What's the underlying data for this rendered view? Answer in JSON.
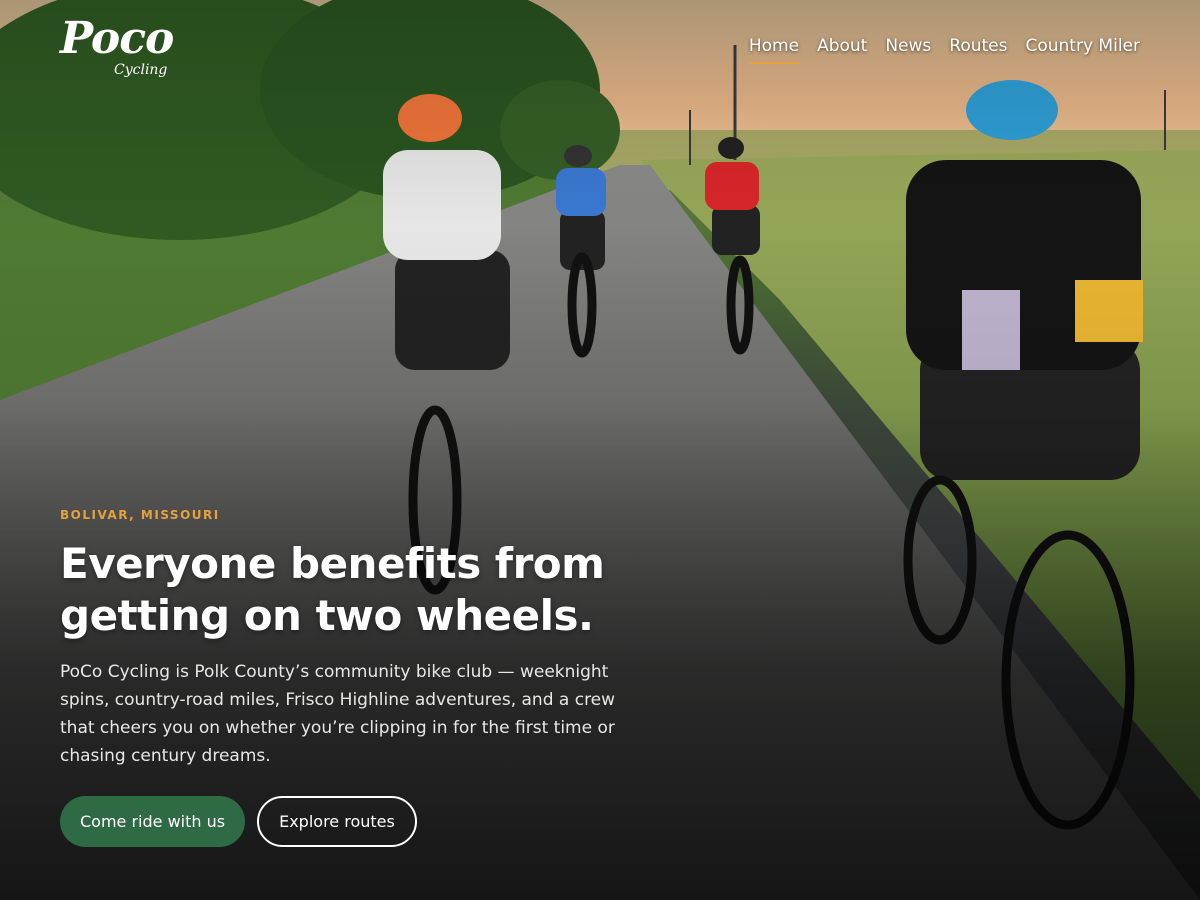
{
  "brand": {
    "logo_main": "Poco",
    "logo_sub": "Cycling"
  },
  "nav": {
    "items": [
      {
        "label": "Home",
        "active": true
      },
      {
        "label": "About",
        "active": false
      },
      {
        "label": "News",
        "active": false
      },
      {
        "label": "Routes",
        "active": false
      },
      {
        "label": "Country Miler",
        "active": false
      }
    ]
  },
  "hero": {
    "eyebrow": "BOLIVAR, MISSOURI",
    "headline": "Everyone benefits from getting on two wheels.",
    "body": "PoCo Cycling is Polk County’s community bike club — weeknight spins, country-road miles, Frisco Highline adventures, and a crew that cheers you on whether you’re clipping in for the first time or chasing century dreams.",
    "primary_button": "Come ride with us",
    "secondary_button": "Explore routes"
  },
  "colors": {
    "accent": "#e6a23c",
    "primary_button": "#2e6b45"
  }
}
